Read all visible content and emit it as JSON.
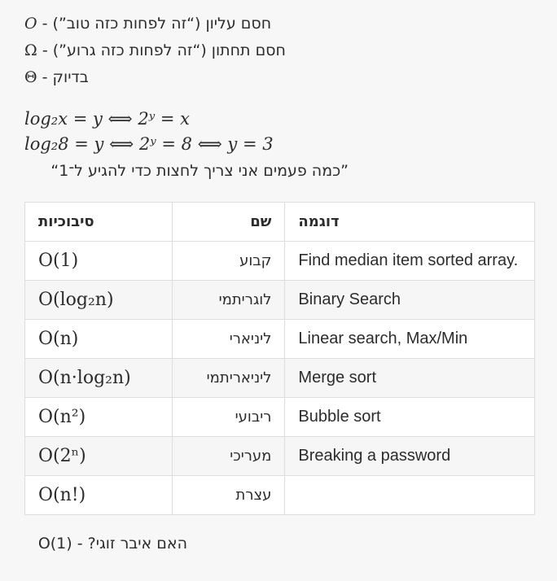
{
  "notation": [
    {
      "symbol": "O",
      "text": "חסם עליון (“זה לפחות כזה טוב”)"
    },
    {
      "symbol": "Ω",
      "text": "חסם תחתון (“זה לפחות כזה גרוע”)"
    },
    {
      "symbol": "Θ",
      "text": "בדיוק"
    }
  ],
  "log": {
    "line1": "log₂x = y ⟺ 2ʸ = x",
    "line2": "log₂8 = y ⟺ 2ʸ = 8 ⟺ y = 3",
    "quote": "”כמה פעמים אני צריך לחצות כדי להגיע ל־1“"
  },
  "table": {
    "headers": {
      "complexity": "סיבוכיות",
      "name": "שם",
      "example": "דוגמה"
    },
    "rows": [
      {
        "complexity": "O(1)",
        "name": "קבוע",
        "example": "Find median item sorted array."
      },
      {
        "complexity": "O(log₂n)",
        "name": "לוגריתמי",
        "example": "Binary Search"
      },
      {
        "complexity": "O(n)",
        "name": "ליניארי",
        "example": "Linear search, Max/Min"
      },
      {
        "complexity": "O(n·log₂n)",
        "name": "ליניאריתמי",
        "example": "Merge sort"
      },
      {
        "complexity": "O(n²)",
        "name": "ריבועי",
        "example": "Bubble sort"
      },
      {
        "complexity": "O(2ⁿ)",
        "name": "מעריכי",
        "example": "Breaking a password"
      },
      {
        "complexity": "O(n!)",
        "name": "עצרת",
        "example": ""
      }
    ]
  },
  "footer": "האם איבר זוגי? - O(1)"
}
